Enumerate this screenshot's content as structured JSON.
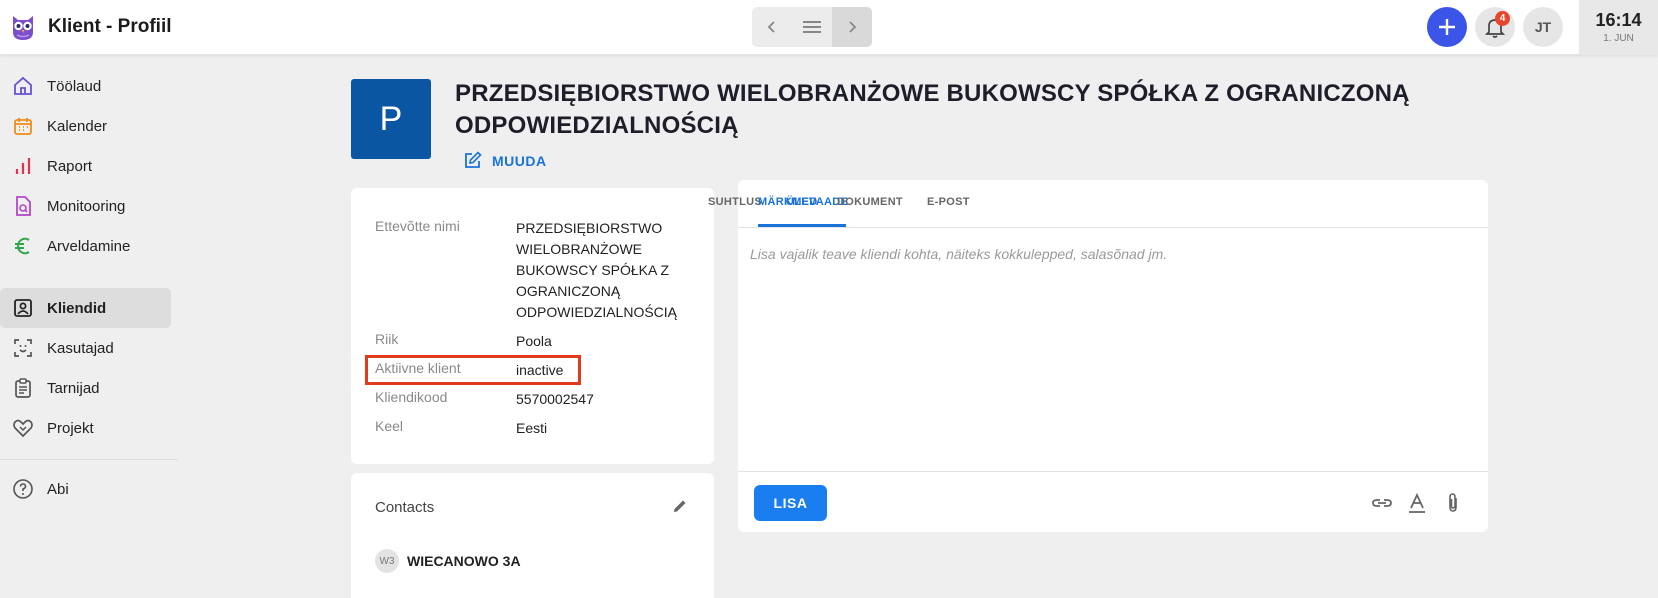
{
  "header": {
    "app_title": "Klient - Profiil",
    "notifications_count": "4",
    "user_initials": "JT",
    "clock_time": "16:14",
    "clock_date": "1. JUN"
  },
  "sidebar": {
    "items": [
      {
        "label": "Töölaud",
        "icon": "home-icon"
      },
      {
        "label": "Kalender",
        "icon": "calendar-icon"
      },
      {
        "label": "Raport",
        "icon": "bar-chart-icon"
      },
      {
        "label": "Monitooring",
        "icon": "document-search-icon"
      },
      {
        "label": "Arveldamine",
        "icon": "euro-icon"
      },
      {
        "label": "Kliendid",
        "icon": "contacts-icon"
      },
      {
        "label": "Kasutajad",
        "icon": "face-scan-icon"
      },
      {
        "label": "Tarnijad",
        "icon": "clipboard-list-icon"
      },
      {
        "label": "Projekt",
        "icon": "handshake-icon"
      },
      {
        "label": "Abi",
        "icon": "help-icon"
      }
    ]
  },
  "company": {
    "avatar_letter": "P",
    "name": "PRZEDSIĘBIORSTWO WIELOBRANŻOWE BUKOWSCY SPÓŁKA Z OGRANICZONĄ ODPOWIEDZIALNOŚCIĄ",
    "edit_label": "MUUDA"
  },
  "info": {
    "rows": [
      {
        "label": "Ettevõtte nimi",
        "value": "PRZEDSIĘBIORSTWO WIELOBRANŻOWE BUKOWSCY SPÓŁKA Z OGRANICZONĄ ODPOWIEDZIALNOŚCIĄ"
      },
      {
        "label": "Riik",
        "value": "Poola"
      },
      {
        "label": "Aktiivne klient",
        "value": "inactive"
      },
      {
        "label": "Kliendikood",
        "value": "5570002547"
      },
      {
        "label": "Keel",
        "value": "Eesti"
      }
    ]
  },
  "contacts": {
    "title": "Contacts",
    "items": [
      {
        "initials": "W3",
        "name": "WIECANOWO 3A"
      }
    ]
  },
  "notes": {
    "tabs": [
      "SUHTLUS",
      "MÄRKMED",
      "ÜLEVAADE",
      "DOKUMENT",
      "E-POST"
    ],
    "active_tab": "MÄRKMED",
    "placeholder": "Lisa vajalik teave kliendi kohta, näiteks kokkulepped, salasõnad jm.",
    "submit_label": "LISA"
  },
  "colors": {
    "brand_blue": "#0a56a3",
    "accent_blue": "#1a7df0",
    "add_button": "#3b55e8",
    "badge_red": "#e8452c",
    "highlight_red": "#e23a1c"
  }
}
